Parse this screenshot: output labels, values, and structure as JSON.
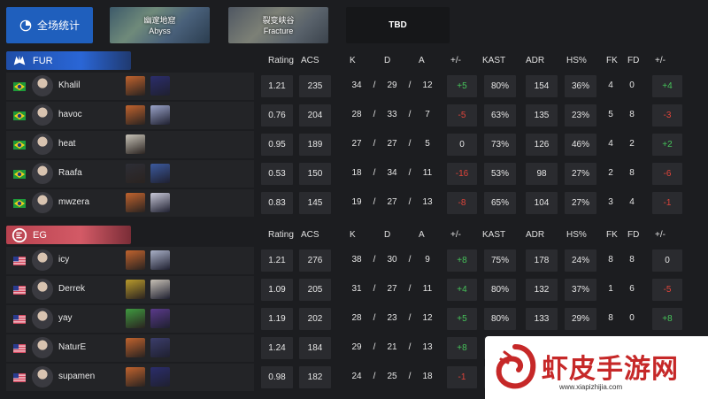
{
  "tabs": {
    "overall": "全场统计",
    "maps": [
      {
        "name_cn": "幽邃地窟",
        "name_en": "Abyss"
      },
      {
        "name_cn": "裂变峡谷",
        "name_en": "Fracture"
      }
    ],
    "tbd": "TBD"
  },
  "columns": [
    "Rating",
    "ACS",
    "K",
    "D",
    "A",
    "+/-",
    "KAST",
    "ADR",
    "HS%",
    "FK",
    "FD",
    "+/-"
  ],
  "teams": [
    {
      "name": "FUR",
      "color": "#2a66d6",
      "players": [
        {
          "name": "Khalil",
          "flag": "brazil",
          "rating": "1.21",
          "acs": "235",
          "k": "34",
          "d": "29",
          "a": "12",
          "pm": "+5",
          "kast": "80%",
          "adr": "154",
          "hs": "36%",
          "fk": "4",
          "fd": "0",
          "fpm": "+4"
        },
        {
          "name": "havoc",
          "flag": "brazil",
          "rating": "0.76",
          "acs": "204",
          "k": "28",
          "d": "33",
          "a": "7",
          "pm": "-5",
          "kast": "63%",
          "adr": "135",
          "hs": "23%",
          "fk": "5",
          "fd": "8",
          "fpm": "-3"
        },
        {
          "name": "heat",
          "flag": "brazil",
          "rating": "0.95",
          "acs": "189",
          "k": "27",
          "d": "27",
          "a": "5",
          "pm": "0",
          "kast": "73%",
          "adr": "126",
          "hs": "46%",
          "fk": "4",
          "fd": "2",
          "fpm": "+2"
        },
        {
          "name": "Raafa",
          "flag": "brazil",
          "rating": "0.53",
          "acs": "150",
          "k": "18",
          "d": "34",
          "a": "11",
          "pm": "-16",
          "kast": "53%",
          "adr": "98",
          "hs": "27%",
          "fk": "2",
          "fd": "8",
          "fpm": "-6"
        },
        {
          "name": "mwzera",
          "flag": "brazil",
          "rating": "0.83",
          "acs": "145",
          "k": "19",
          "d": "27",
          "a": "13",
          "pm": "-8",
          "kast": "65%",
          "adr": "104",
          "hs": "27%",
          "fk": "3",
          "fd": "4",
          "fpm": "-1"
        }
      ]
    },
    {
      "name": "EG",
      "color": "#d35a66",
      "players": [
        {
          "name": "icy",
          "flag": "usa",
          "rating": "1.21",
          "acs": "276",
          "k": "38",
          "d": "30",
          "a": "9",
          "pm": "+8",
          "kast": "75%",
          "adr": "178",
          "hs": "24%",
          "fk": "8",
          "fd": "8",
          "fpm": "0"
        },
        {
          "name": "Derrek",
          "flag": "usa",
          "rating": "1.09",
          "acs": "205",
          "k": "31",
          "d": "27",
          "a": "11",
          "pm": "+4",
          "kast": "80%",
          "adr": "132",
          "hs": "37%",
          "fk": "1",
          "fd": "6",
          "fpm": "-5"
        },
        {
          "name": "yay",
          "flag": "usa",
          "rating": "1.19",
          "acs": "202",
          "k": "28",
          "d": "23",
          "a": "12",
          "pm": "+5",
          "kast": "80%",
          "adr": "133",
          "hs": "29%",
          "fk": "8",
          "fd": "0",
          "fpm": "+8"
        },
        {
          "name": "NaturE",
          "flag": "usa",
          "rating": "1.24",
          "acs": "184",
          "k": "29",
          "d": "21",
          "a": "13",
          "pm": "+8",
          "kast": "",
          "adr": "",
          "hs": "",
          "fk": "",
          "fd": "",
          "fpm": ""
        },
        {
          "name": "supamen",
          "flag": "usa",
          "rating": "0.98",
          "acs": "182",
          "k": "24",
          "d": "25",
          "a": "18",
          "pm": "-1",
          "kast": "",
          "adr": "",
          "hs": "",
          "fk": "",
          "fd": "",
          "fpm": ""
        }
      ]
    }
  ],
  "watermark": {
    "title": "虾皮手游网",
    "url": "www.xiapizhijia.com"
  }
}
